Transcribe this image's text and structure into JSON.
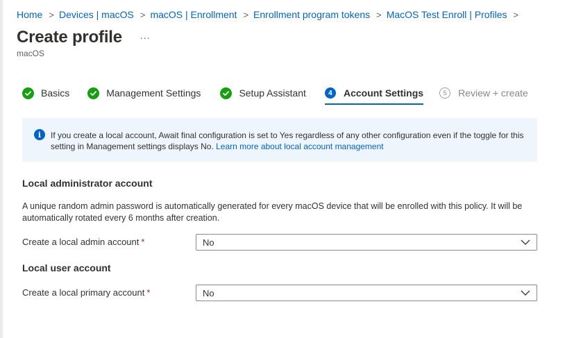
{
  "breadcrumb": {
    "items": [
      {
        "label": "Home"
      },
      {
        "label": "Devices | macOS"
      },
      {
        "label": "macOS | Enrollment"
      },
      {
        "label": "Enrollment program tokens"
      },
      {
        "label": "MacOS Test Enroll | Profiles"
      }
    ],
    "separator": ">"
  },
  "header": {
    "title": "Create profile",
    "more": "...",
    "subtitle": "macOS"
  },
  "steps": [
    {
      "label": "Basics",
      "state": "done"
    },
    {
      "label": "Management Settings",
      "state": "done"
    },
    {
      "label": "Setup Assistant",
      "state": "done"
    },
    {
      "label": "Account Settings",
      "number": "4",
      "state": "current"
    },
    {
      "label": "Review + create",
      "number": "5",
      "state": "todo"
    }
  ],
  "info": {
    "icon": "info-icon",
    "text": "If you create a local account, Await final configuration is set to Yes regardless of any other configuration even if the toggle for this setting in Management settings displays No. ",
    "link": "Learn more about local account management"
  },
  "local_admin": {
    "heading": "Local administrator account",
    "description": "A unique random admin password is automatically generated for every macOS device that will be enrolled with this policy. It will be automatically rotated every 6 months after creation.",
    "field_label": "Create a local admin account",
    "required_mark": "*",
    "value": "No"
  },
  "local_user": {
    "heading": "Local user account",
    "field_label": "Create a local primary account",
    "required_mark": "*",
    "value": "No"
  },
  "colors": {
    "accent": "#0064c8",
    "success": "#13a10e",
    "required": "#a4262c",
    "info_bg": "#eef5fc"
  }
}
